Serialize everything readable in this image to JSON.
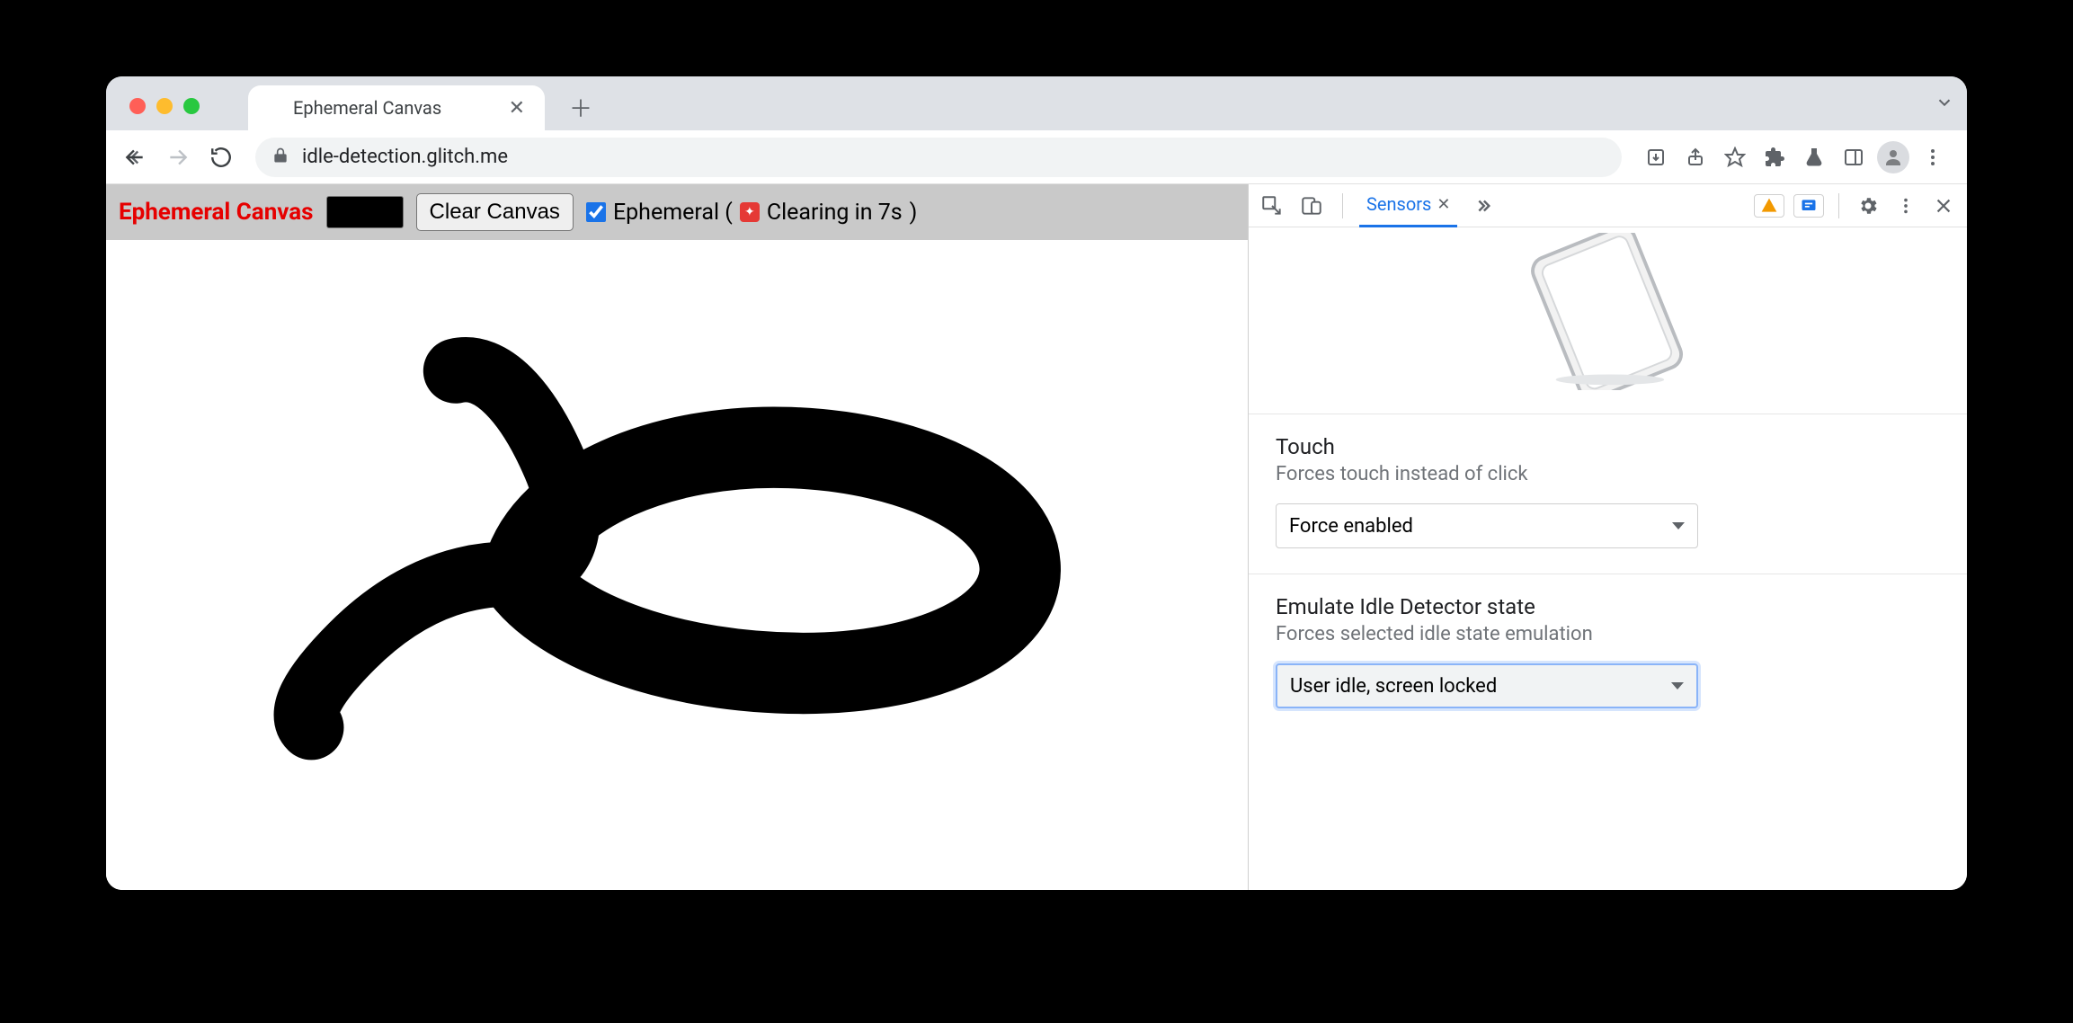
{
  "browser": {
    "tab": {
      "title": "Ephemeral Canvas"
    },
    "url": "idle-detection.glitch.me"
  },
  "page": {
    "title": "Ephemeral Canvas",
    "clear_button": "Clear Canvas",
    "ephemeral_label_prefix": "Ephemeral (",
    "ephemeral_countdown": "Clearing in 7s",
    "ephemeral_label_suffix": ")",
    "ephemeral_checked": true,
    "color_value": "#000000"
  },
  "devtools": {
    "active_tab": "Sensors",
    "sections": {
      "touch": {
        "title": "Touch",
        "subtitle": "Forces touch instead of click",
        "value": "Force enabled"
      },
      "idle": {
        "title": "Emulate Idle Detector state",
        "subtitle": "Forces selected idle state emulation",
        "value": "User idle, screen locked"
      }
    }
  }
}
